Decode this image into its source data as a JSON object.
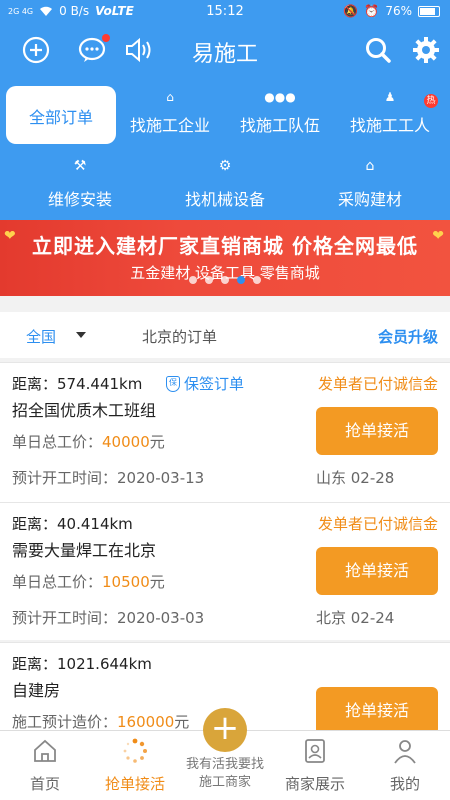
{
  "status_bar": {
    "signal_text": "2G 4G",
    "network_speed": "0 B/s",
    "volte": "VoLTE",
    "time": "15:12",
    "battery": "76%"
  },
  "header": {
    "title": "易施工",
    "icons": [
      "add-circle-icon",
      "message-icon",
      "speaker-icon",
      "search-icon",
      "gear-icon"
    ]
  },
  "categories": {
    "row1": [
      {
        "label": "全部订单",
        "icon": "",
        "active": true
      },
      {
        "label": "找施工企业",
        "icon": "home-icon"
      },
      {
        "label": "找施工队伍",
        "icon": "team-icon"
      },
      {
        "label": "找施工工人",
        "icon": "worker-icon",
        "badge": "热"
      }
    ],
    "row2": [
      {
        "label": "维修安装",
        "icon": "hammer-icon"
      },
      {
        "label": "找机械设备",
        "icon": "cog-icon"
      },
      {
        "label": "采购建材",
        "icon": "store-icon"
      }
    ]
  },
  "banner": {
    "headline": "立即进入建材厂家直销商城 价格全网最低",
    "subline": "五金建材 设备工具 零售商城",
    "slide_count": 5,
    "active_slide": 4
  },
  "filter": {
    "region": "全国",
    "city_orders": "北京的订单",
    "vip": "会员升级"
  },
  "orders": [
    {
      "distance": "距离：574.441km",
      "guarantee": "保签订单",
      "paid": "发单者已付诚信金",
      "title": "招全国优质木工班组",
      "price_label": "单日总工价：",
      "price": "40000",
      "price_unit": "元",
      "date_label": "预计开工时间：",
      "date": "2020-03-13",
      "location": "山东 02-28",
      "button": "抢单接活"
    },
    {
      "distance": "距离：40.414km",
      "guarantee": "",
      "paid": "发单者已付诚信金",
      "title": "需要大量焊工在北京",
      "price_label": "单日总工价：",
      "price": "10500",
      "price_unit": "元",
      "date_label": "预计开工时间：",
      "date": "2020-03-03",
      "location": "北京 02-24",
      "button": "抢单接活"
    },
    {
      "distance": "距离：1021.644km",
      "guarantee": "",
      "paid": "",
      "title": "自建房",
      "price_label": "施工预计造价：",
      "price": "160000",
      "price_unit": "元",
      "date_label": "",
      "date": "",
      "location": "",
      "button": "抢单接活"
    }
  ],
  "bottom_nav": {
    "home": "首页",
    "grab": "抢单接活",
    "center_line1": "我有活我要找",
    "center_line2": "施工商家",
    "merchants": "商家展示",
    "mine": "我的"
  },
  "colors": {
    "brand_blue": "#3e9bf0",
    "accent_orange": "#f39a23",
    "price_orange": "#f08c18",
    "banner_red": "#e33a2e"
  }
}
